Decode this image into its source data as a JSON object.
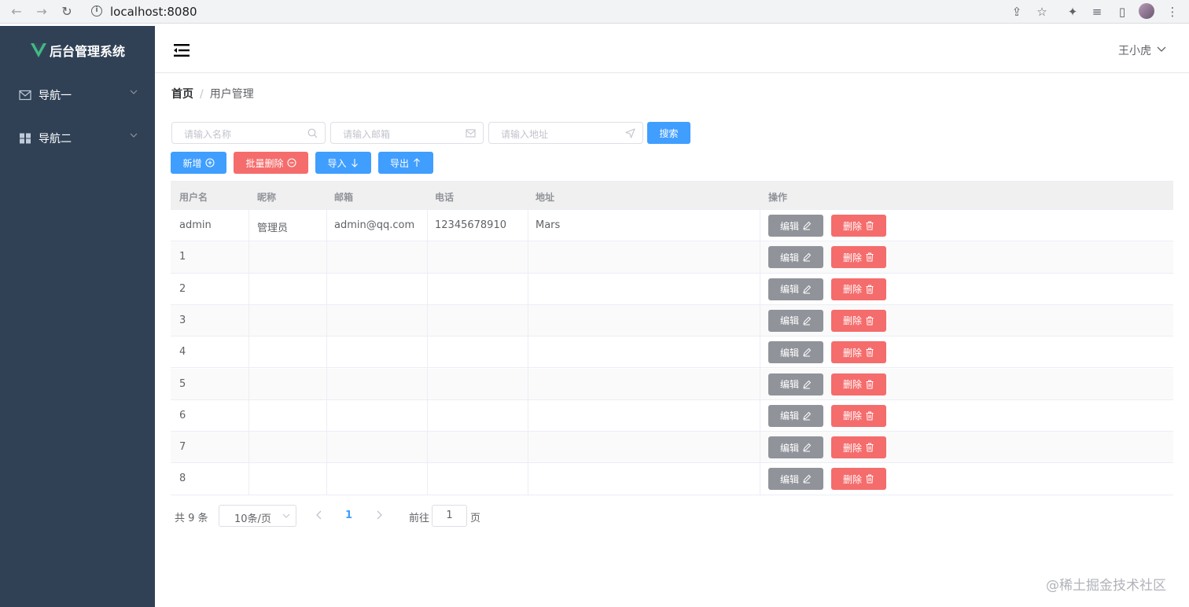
{
  "browser": {
    "url": "localhost:8080"
  },
  "sidebar": {
    "title": "后台管理系统",
    "items": [
      {
        "label": "导航一",
        "icon": "mail-icon"
      },
      {
        "label": "导航二",
        "icon": "grid-icon"
      }
    ]
  },
  "header": {
    "user": "王小虎"
  },
  "breadcrumb": {
    "home": "首页",
    "separator": "/",
    "current": "用户管理"
  },
  "search": {
    "name_placeholder": "请输入名称",
    "email_placeholder": "请输入邮箱",
    "address_placeholder": "请输入地址",
    "button": "搜索"
  },
  "toolbar": {
    "add": "新增",
    "batch_delete": "批量删除",
    "import": "导入",
    "export": "导出"
  },
  "table": {
    "columns": [
      "用户名",
      "昵称",
      "邮箱",
      "电话",
      "地址",
      "操作"
    ],
    "rows": [
      {
        "username": "admin",
        "nickname": "管理员",
        "email": "admin@qq.com",
        "phone": "12345678910",
        "address": "Mars"
      },
      {
        "username": "1",
        "nickname": "",
        "email": "",
        "phone": "",
        "address": ""
      },
      {
        "username": "2",
        "nickname": "",
        "email": "",
        "phone": "",
        "address": ""
      },
      {
        "username": "3",
        "nickname": "",
        "email": "",
        "phone": "",
        "address": ""
      },
      {
        "username": "4",
        "nickname": "",
        "email": "",
        "phone": "",
        "address": ""
      },
      {
        "username": "5",
        "nickname": "",
        "email": "",
        "phone": "",
        "address": ""
      },
      {
        "username": "6",
        "nickname": "",
        "email": "",
        "phone": "",
        "address": ""
      },
      {
        "username": "7",
        "nickname": "",
        "email": "",
        "phone": "",
        "address": ""
      },
      {
        "username": "8",
        "nickname": "",
        "email": "",
        "phone": "",
        "address": ""
      }
    ],
    "edit_label": "编辑",
    "delete_label": "删除"
  },
  "pagination": {
    "total": "共 9 条",
    "page_size": "10条/页",
    "current_page": "1",
    "goto_label": "前往",
    "goto_value": "1",
    "goto_unit": "页"
  },
  "watermark": "@稀土掘金技术社区",
  "colors": {
    "sidebar": "#304156",
    "primary": "#409eff",
    "danger": "#f56c6c",
    "gray": "#909399",
    "vue_green": "#42b983"
  }
}
